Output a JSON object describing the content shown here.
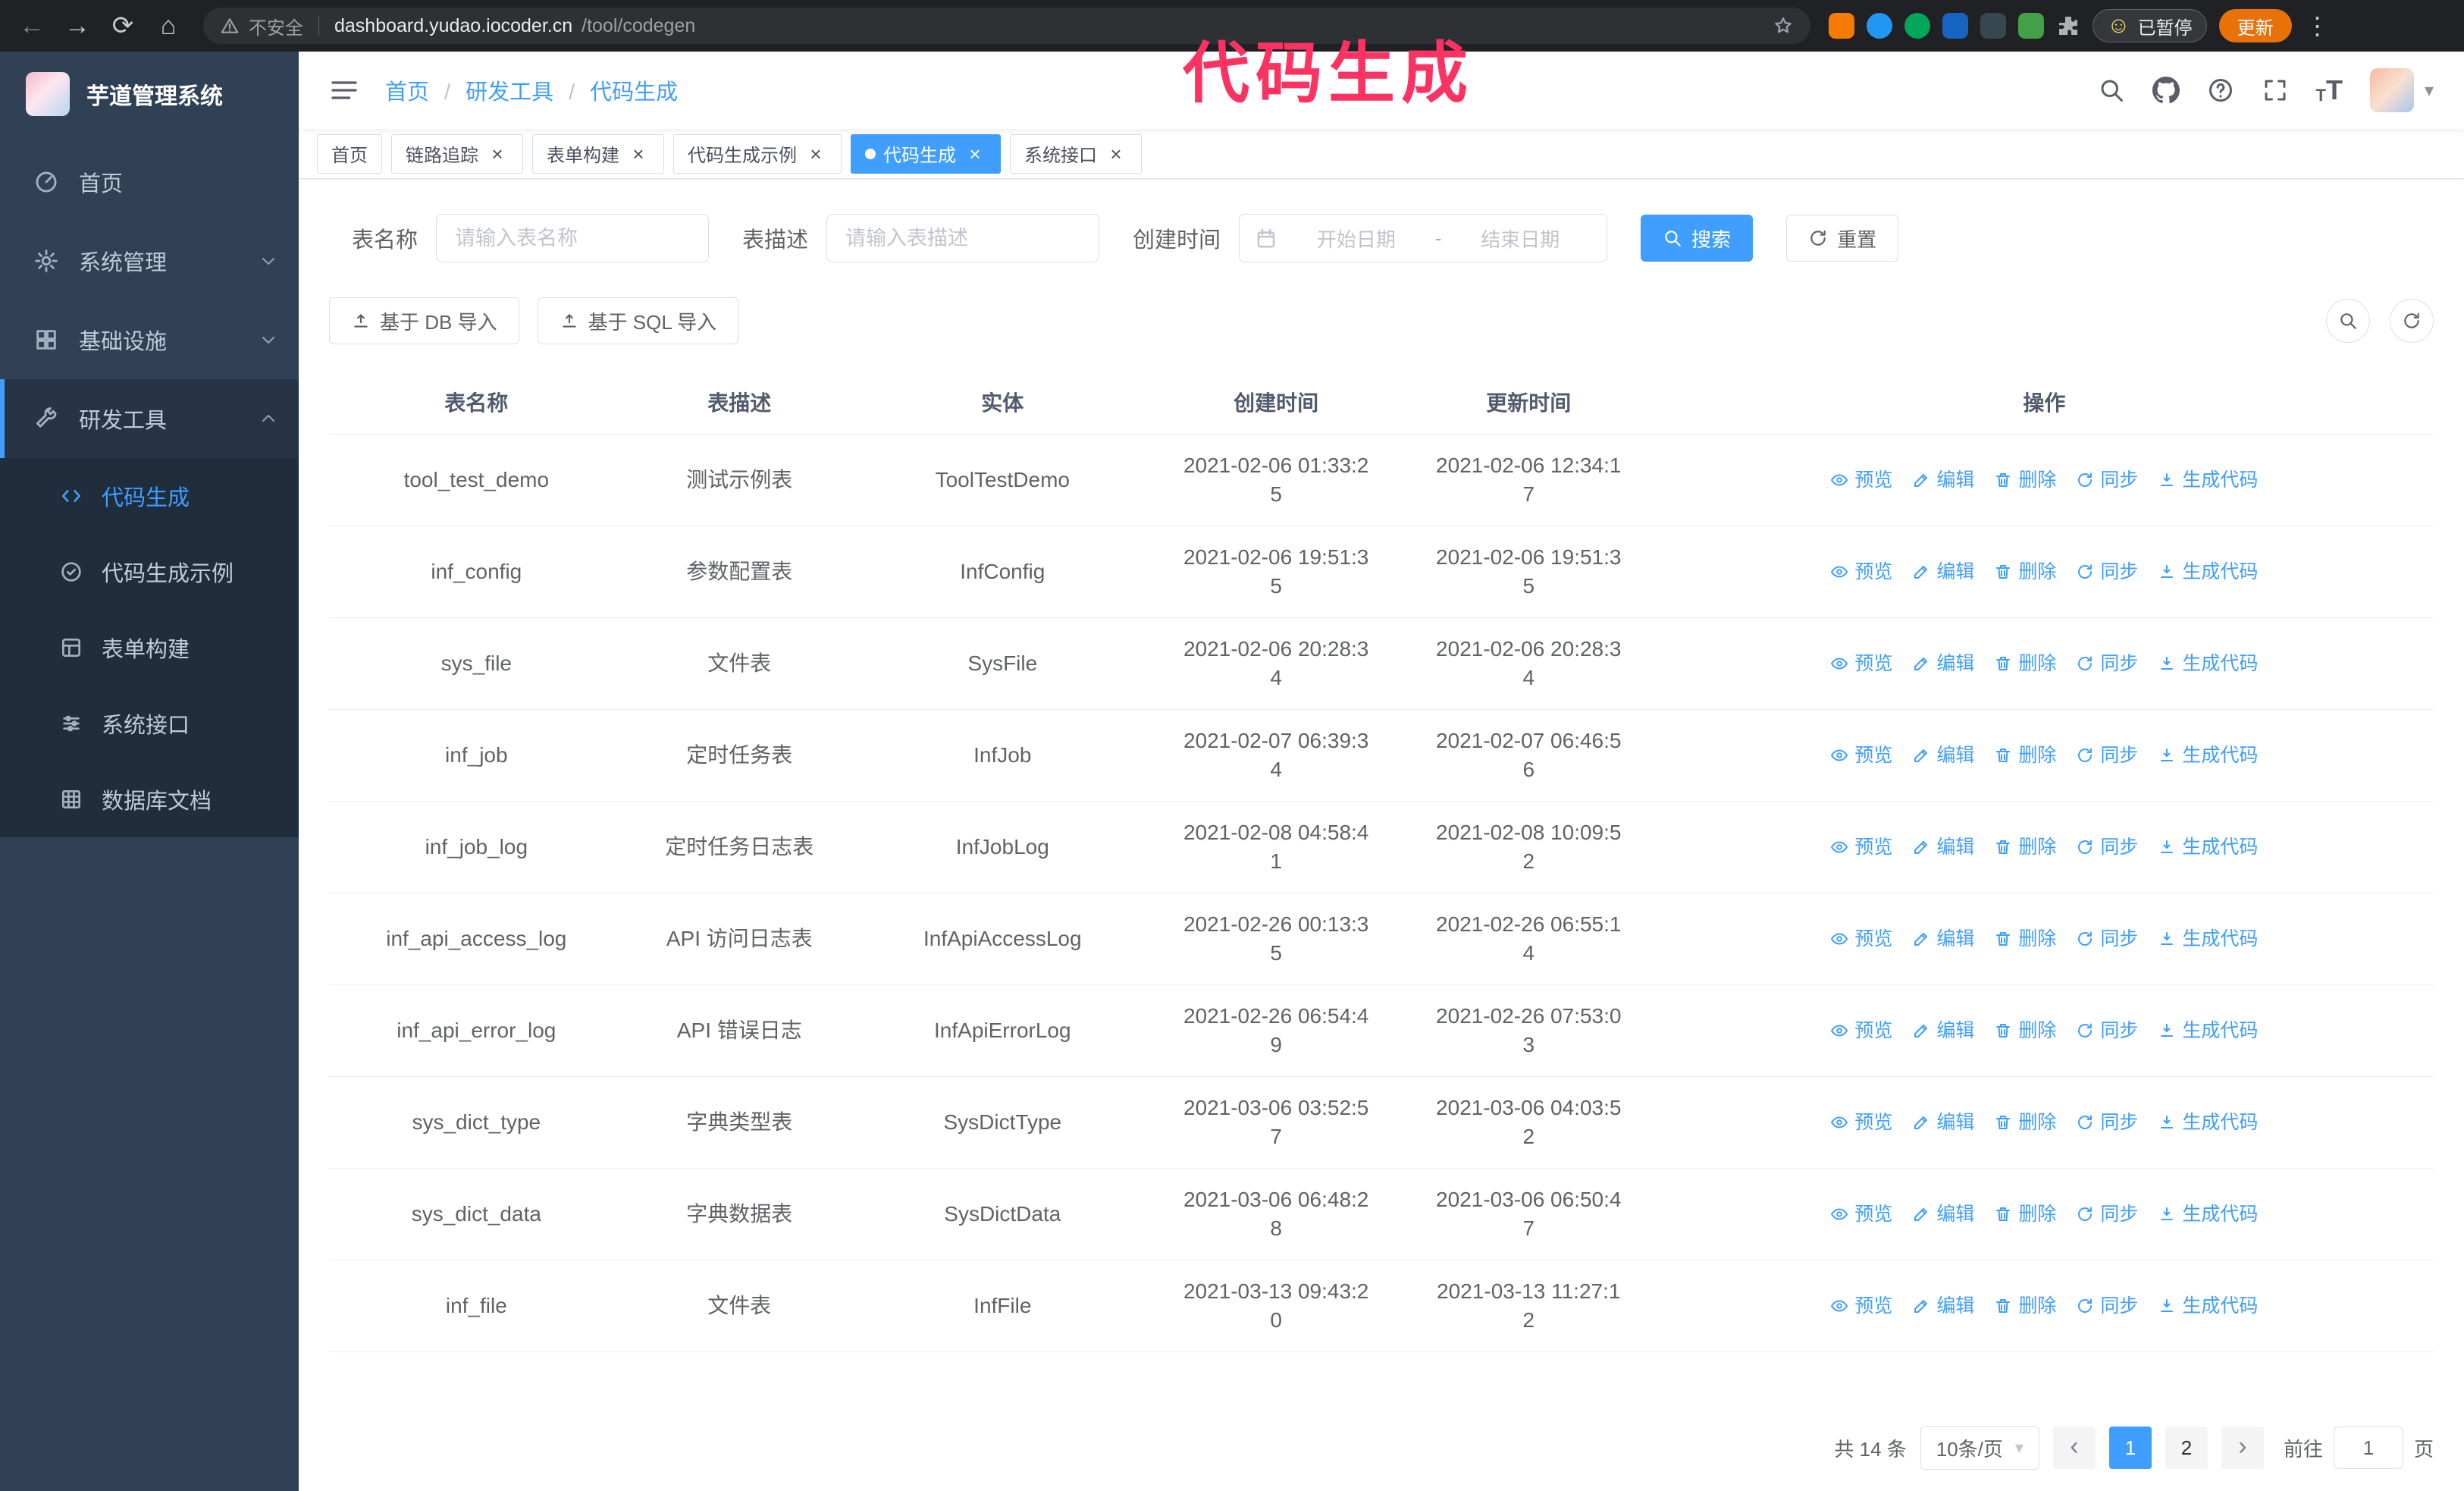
{
  "annotation": {
    "text": "代码生成"
  },
  "browser": {
    "security_label": "不安全",
    "url_host": "dashboard.yudao.iocoder.cn",
    "url_path": "/tool/codegen",
    "paused_badge": "已暂停",
    "update_button": "更新"
  },
  "sidebar": {
    "logo_title": "芋道管理系统",
    "menu": [
      {
        "label": "首页",
        "icon": "dashboard-icon"
      },
      {
        "label": "系统管理",
        "icon": "gear-icon",
        "group": true
      },
      {
        "label": "基础设施",
        "icon": "grid-icon",
        "group": true
      },
      {
        "label": "研发工具",
        "icon": "tool-icon",
        "group": true,
        "expanded": true,
        "open": true
      }
    ],
    "submenu": [
      {
        "label": "代码生成",
        "icon": "code-icon",
        "active": true
      },
      {
        "label": "代码生成示例",
        "icon": "example-icon"
      },
      {
        "label": "表单构建",
        "icon": "form-icon"
      },
      {
        "label": "系统接口",
        "icon": "api-icon"
      },
      {
        "label": "数据库文档",
        "icon": "db-icon"
      }
    ]
  },
  "header": {
    "breadcrumb": [
      {
        "label": "首页"
      },
      {
        "label": "研发工具"
      },
      {
        "label": "代码生成"
      }
    ]
  },
  "tabs": [
    {
      "label": "首页"
    },
    {
      "label": "链路追踪",
      "closable": true
    },
    {
      "label": "表单构建",
      "closable": true
    },
    {
      "label": "代码生成示例",
      "closable": true
    },
    {
      "label": "代码生成",
      "closable": true,
      "active": true
    },
    {
      "label": "系统接口",
      "closable": true
    }
  ],
  "filters": {
    "name_label": "表名称",
    "name_placeholder": "请输入表名称",
    "desc_label": "表描述",
    "desc_placeholder": "请输入表描述",
    "time_label": "创建时间",
    "start_placeholder": "开始日期",
    "range_separator": "-",
    "end_placeholder": "结束日期",
    "search_button": "搜索",
    "reset_button": "重置"
  },
  "toolbar": {
    "import_db_button": "基于 DB 导入",
    "import_sql_button": "基于 SQL 导入"
  },
  "table": {
    "columns": [
      "表名称",
      "表描述",
      "实体",
      "创建时间",
      "更新时间",
      "操作"
    ],
    "rows": [
      {
        "name": "tool_test_demo",
        "desc": "测试示例表",
        "entity": "ToolTestDemo",
        "created": "2021-02-06 01:33:25",
        "updated": "2021-02-06 12:34:17"
      },
      {
        "name": "inf_config",
        "desc": "参数配置表",
        "entity": "InfConfig",
        "created": "2021-02-06 19:51:35",
        "updated": "2021-02-06 19:51:35"
      },
      {
        "name": "sys_file",
        "desc": "文件表",
        "entity": "SysFile",
        "created": "2021-02-06 20:28:34",
        "updated": "2021-02-06 20:28:34"
      },
      {
        "name": "inf_job",
        "desc": "定时任务表",
        "entity": "InfJob",
        "created": "2021-02-07 06:39:34",
        "updated": "2021-02-07 06:46:56"
      },
      {
        "name": "inf_job_log",
        "desc": "定时任务日志表",
        "entity": "InfJobLog",
        "created": "2021-02-08 04:58:41",
        "updated": "2021-02-08 10:09:52"
      },
      {
        "name": "inf_api_access_log",
        "desc": "API 访问日志表",
        "entity": "InfApiAccessLog",
        "created": "2021-02-26 00:13:35",
        "updated": "2021-02-26 06:55:14"
      },
      {
        "name": "inf_api_error_log",
        "desc": "API 错误日志",
        "entity": "InfApiErrorLog",
        "created": "2021-02-26 06:54:49",
        "updated": "2021-02-26 07:53:03"
      },
      {
        "name": "sys_dict_type",
        "desc": "字典类型表",
        "entity": "SysDictType",
        "created": "2021-03-06 03:52:57",
        "updated": "2021-03-06 04:03:52"
      },
      {
        "name": "sys_dict_data",
        "desc": "字典数据表",
        "entity": "SysDictData",
        "created": "2021-03-06 06:48:28",
        "updated": "2021-03-06 06:50:47"
      },
      {
        "name": "inf_file",
        "desc": "文件表",
        "entity": "InfFile",
        "created": "2021-03-13 09:43:20",
        "updated": "2021-03-13 11:27:12"
      }
    ],
    "actions": [
      {
        "label": "预览",
        "icon": "eye-icon"
      },
      {
        "label": "编辑",
        "icon": "edit-icon"
      },
      {
        "label": "删除",
        "icon": "trash-icon"
      },
      {
        "label": "同步",
        "icon": "sync-icon"
      },
      {
        "label": "生成代码",
        "icon": "download-icon"
      }
    ]
  },
  "pagination": {
    "total_text": "共 14 条",
    "page_size": "10条/页",
    "pages": [
      {
        "label": "1",
        "active": true
      },
      {
        "label": "2"
      }
    ],
    "goto_prefix": "前往",
    "goto_value": "1",
    "goto_suffix": "页"
  },
  "colors": {
    "accent": "#409eff",
    "sidebar_bg": "#304156",
    "submenu_bg": "#1f2d3d",
    "active_tab_bg": "#409eff",
    "annotation_text": "#fb3262",
    "update_button_bg": "#e8710a"
  }
}
